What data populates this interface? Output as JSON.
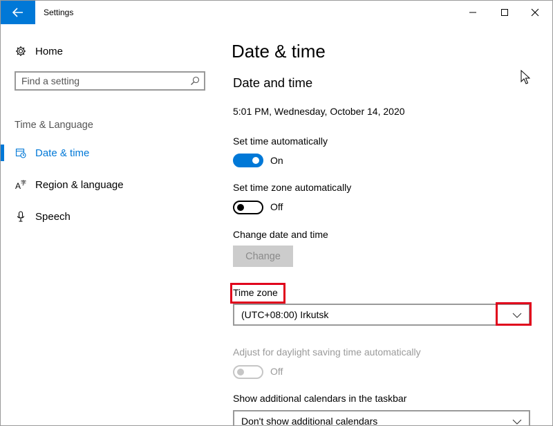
{
  "window": {
    "title": "Settings"
  },
  "sidebar": {
    "home_label": "Home",
    "search_placeholder": "Find a setting",
    "section_label": "Time & Language",
    "items": [
      {
        "label": "Date & time",
        "icon": "calendar-clock-icon",
        "active": true
      },
      {
        "label": "Region & language",
        "icon": "language-icon",
        "active": false
      },
      {
        "label": "Speech",
        "icon": "microphone-icon",
        "active": false
      }
    ]
  },
  "main": {
    "page_title": "Date & time",
    "section_title": "Date and time",
    "current_datetime": "5:01 PM, Wednesday, October 14, 2020",
    "set_time_auto": {
      "label": "Set time automatically",
      "state": "On"
    },
    "set_timezone_auto": {
      "label": "Set time zone automatically",
      "state": "Off"
    },
    "change_datetime": {
      "label": "Change date and time",
      "button": "Change"
    },
    "time_zone": {
      "label": "Time zone",
      "value": "(UTC+08:00) Irkutsk"
    },
    "daylight_saving": {
      "label": "Adjust for daylight saving time automatically",
      "state": "Off"
    },
    "additional_calendars": {
      "label": "Show additional calendars in the taskbar",
      "value": "Don't show additional calendars"
    }
  },
  "colors": {
    "accent": "#0078d7",
    "highlight": "#e0001b",
    "disabled_text": "#9a9a9a"
  }
}
